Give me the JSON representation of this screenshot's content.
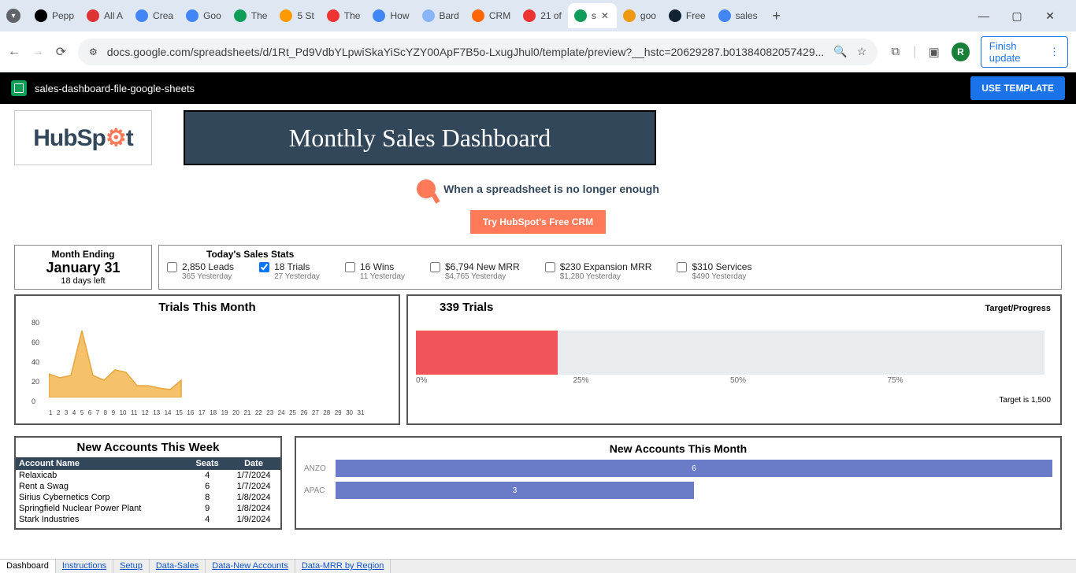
{
  "browser": {
    "tabs": [
      "Pepp",
      "All A",
      "Crea",
      "Goo",
      "The",
      "5 St",
      "The",
      "How",
      "Bard",
      "CRM",
      "21 of",
      "s",
      "goo",
      "Free",
      "sales"
    ],
    "active_tab_index": 11,
    "url": "docs.google.com/spreadsheets/d/1Rt_Pd9VdbYLpwiSkaYiScYZY00ApF7B5o-LxugJhul0/template/preview?__hstc=20629287.b01384082057429...",
    "profile_letter": "R",
    "update_label": "Finish update"
  },
  "header": {
    "filename": "sales-dashboard-file-google-sheets",
    "use_template": "USE TEMPLATE"
  },
  "brand": {
    "name": "HubSpot",
    "title": "Monthly Sales Dashboard",
    "cta_line": "When a spreadsheet is no longer enough",
    "try_button": "Try HubSpot's Free CRM"
  },
  "month_ending": {
    "label": "Month Ending",
    "date": "January 31",
    "sub": "18 days left"
  },
  "stats": {
    "title": "Today's Sales Stats",
    "items": [
      {
        "checked": false,
        "main": "2,850 Leads",
        "sub": "365 Yesterday"
      },
      {
        "checked": true,
        "main": "18 Trials",
        "sub": "27 Yesterday"
      },
      {
        "checked": false,
        "main": "16 Wins",
        "sub": "11 Yesterday"
      },
      {
        "checked": false,
        "main": "$6,794 New MRR",
        "sub": "$4,765 Yesterday"
      },
      {
        "checked": false,
        "main": "$230 Expansion MRR",
        "sub": "$1,280 Yesterday"
      },
      {
        "checked": false,
        "main": "$310 Services",
        "sub": "$490 Yesterday"
      }
    ]
  },
  "trials_chart": {
    "title": "Trials This Month"
  },
  "progress_chart": {
    "title": "339 Trials",
    "target_progress": "Target/Progress",
    "target_label": "Target is 1,500",
    "percent": 22.6
  },
  "new_accounts_week": {
    "title": "New Accounts This Week",
    "columns": [
      "Account Name",
      "Seats",
      "Date"
    ],
    "rows": [
      [
        "Relaxicab",
        "4",
        "1/7/2024"
      ],
      [
        "Rent a Swag",
        "6",
        "1/7/2024"
      ],
      [
        "Sirius Cybernetics Corp",
        "8",
        "1/8/2024"
      ],
      [
        "Springfield Nuclear Power Plant",
        "9",
        "1/8/2024"
      ],
      [
        "Stark Industries",
        "4",
        "1/9/2024"
      ]
    ]
  },
  "new_accounts_month": {
    "title": "New Accounts This Month",
    "bars": [
      {
        "label": "ANZO",
        "value": 6,
        "width": 100
      },
      {
        "label": "APAC",
        "value": 3,
        "width": 50
      }
    ]
  },
  "sheet_tabs": [
    "Dashboard",
    "Instructions",
    "Setup",
    "Data-Sales",
    "Data-New Accounts",
    "Data-MRR by Region"
  ],
  "chart_data": [
    {
      "type": "area",
      "title": "Trials This Month",
      "x": [
        1,
        2,
        3,
        4,
        5,
        6,
        7,
        8,
        9,
        10,
        11,
        12,
        13
      ],
      "values": [
        24,
        20,
        22,
        68,
        22,
        18,
        28,
        26,
        12,
        12,
        10,
        8,
        18
      ],
      "xlim": [
        1,
        31
      ],
      "ylim": [
        0,
        80
      ],
      "yticks": [
        0,
        20,
        40,
        60,
        80
      ]
    },
    {
      "type": "bar",
      "title": "Target/Progress",
      "series_label": "339 Trials",
      "target": 1500,
      "current": 339,
      "percent_ticks": [
        "0%",
        "25%",
        "50%",
        "75%"
      ]
    },
    {
      "type": "bar",
      "title": "New Accounts This Month",
      "categories": [
        "ANZO",
        "APAC"
      ],
      "values": [
        6,
        3
      ]
    }
  ]
}
